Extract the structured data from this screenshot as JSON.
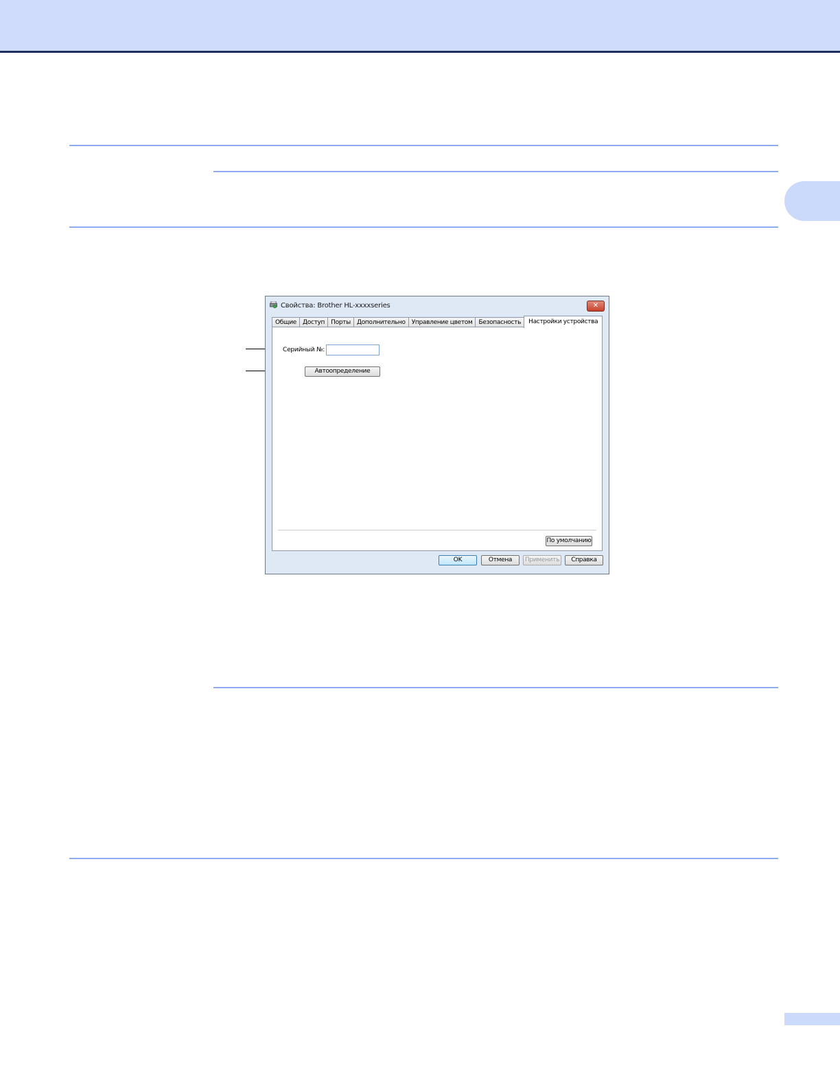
{
  "dialog": {
    "title": "Свойства: Brother HL-xxxxseries",
    "close_glyph": "✕",
    "tabs": [
      {
        "label": "Общие"
      },
      {
        "label": "Доступ"
      },
      {
        "label": "Порты"
      },
      {
        "label": "Дополнительно"
      },
      {
        "label": "Управление цветом"
      },
      {
        "label": "Безопасность"
      },
      {
        "label": "Настройки устройства",
        "active": true
      }
    ],
    "serial_label": "Серийный №:",
    "serial_value": "",
    "autodetect_label": "Автоопределение",
    "default_label": "По умолчанию",
    "buttons": {
      "ok": "OK",
      "cancel": "Отмена",
      "apply": "Применить",
      "help": "Справка"
    }
  },
  "icons": {
    "title": "printer-icon",
    "close": "close-icon"
  },
  "colors": {
    "header_band": "#cfdcfb",
    "rule": "#8fabef",
    "side_tab": "#cbdafb"
  }
}
